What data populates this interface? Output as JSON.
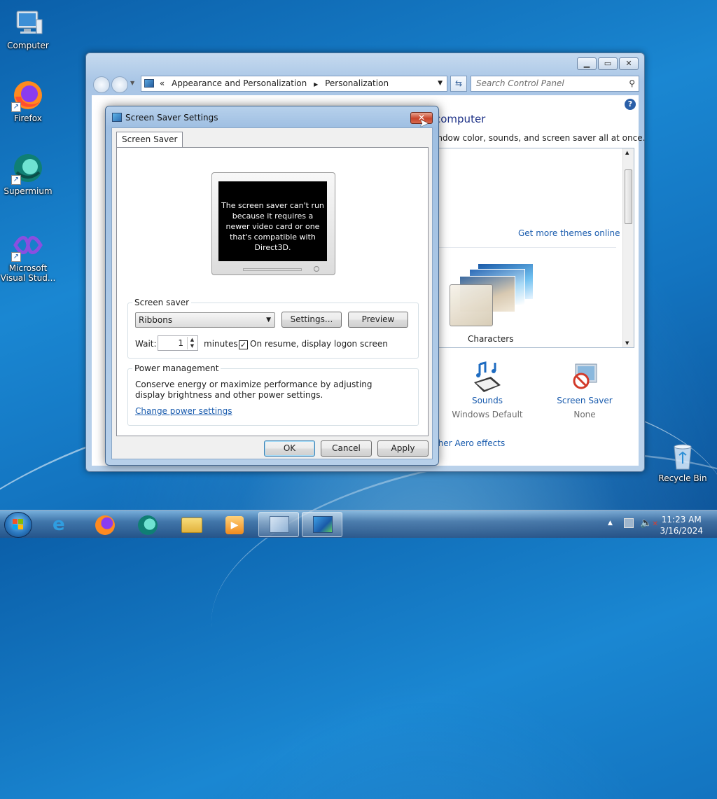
{
  "desktop": {
    "icons": [
      {
        "label": "Computer"
      },
      {
        "label": "Firefox"
      },
      {
        "label": "Supermium"
      },
      {
        "label": "Microsoft Visual Stud..."
      },
      {
        "label": "Recycle Bin"
      }
    ]
  },
  "control_panel": {
    "breadcrumb": [
      "«",
      "Appearance and Personalization",
      "Personalization"
    ],
    "search_placeholder": "Search Control Panel",
    "heading_partial": "computer",
    "subheading_partial": "indow color, sounds, and screen saver all at once.",
    "more_themes_link": "Get more themes online",
    "theme_name": "Characters",
    "sounds_label": "Sounds",
    "sounds_value": "Windows Default",
    "screensaver_label": "Screen Saver",
    "screensaver_value": "None",
    "aero_link_partial": "ther Aero effects"
  },
  "dialog": {
    "title": "Screen Saver Settings",
    "tab": "Screen Saver",
    "preview_message": "The screen saver can't run because it requires a newer video card or one that's compatible with Direct3D.",
    "screen_saver_group": "Screen saver",
    "selected_saver": "Ribbons",
    "settings_button": "Settings...",
    "preview_button": "Preview",
    "wait_label": "Wait:",
    "wait_value": "1",
    "minutes_label": "minutes",
    "resume_checkbox_label": "On resume, display logon screen",
    "resume_checked": true,
    "power_group": "Power management",
    "power_text": "Conserve energy or maximize performance by adjusting display brightness and other power settings.",
    "power_link": "Change power settings",
    "ok": "OK",
    "cancel": "Cancel",
    "apply": "Apply"
  },
  "taskbar": {
    "pinned": [
      "internet-explorer-icon",
      "firefox-icon",
      "supermium-icon",
      "file-explorer-icon",
      "media-player-icon",
      "control-panel-icon",
      "screen-saver-icon"
    ],
    "time": "11:23 AM",
    "date": "3/16/2024"
  }
}
